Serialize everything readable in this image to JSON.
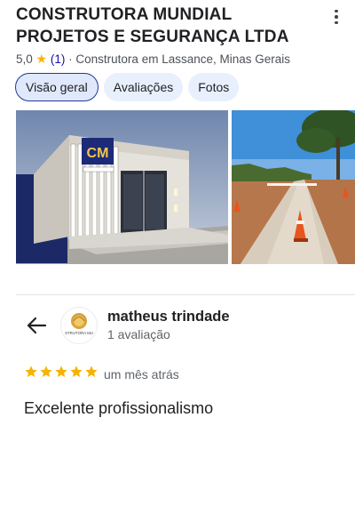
{
  "place": {
    "title": "CONSTRUTORA MUNDIAL PROJETOS E SEGURANÇA LTDA",
    "rating": "5,0",
    "review_count": "(1)",
    "separator": "·",
    "category": "Construtora em Lassance, Minas Gerais"
  },
  "tabs": [
    {
      "label": "Visão geral",
      "active": true
    },
    {
      "label": "Avaliações",
      "active": false
    },
    {
      "label": "Fotos",
      "active": false
    }
  ],
  "photos": {
    "storefront_sign_letters": "CM"
  },
  "review": {
    "reviewer_name": "matheus trindade",
    "reviewer_reviews": "1 avaliação",
    "avatar_text": "STRUTORA MU",
    "stars": 5,
    "date": "um mês atrás",
    "text": "Excelente profissionalismo"
  },
  "colors": {
    "star": "#f5b400",
    "accent_link": "#1a0dab",
    "tab_bg": "#e8f0fe",
    "tab_active_border": "#1f3a93"
  }
}
